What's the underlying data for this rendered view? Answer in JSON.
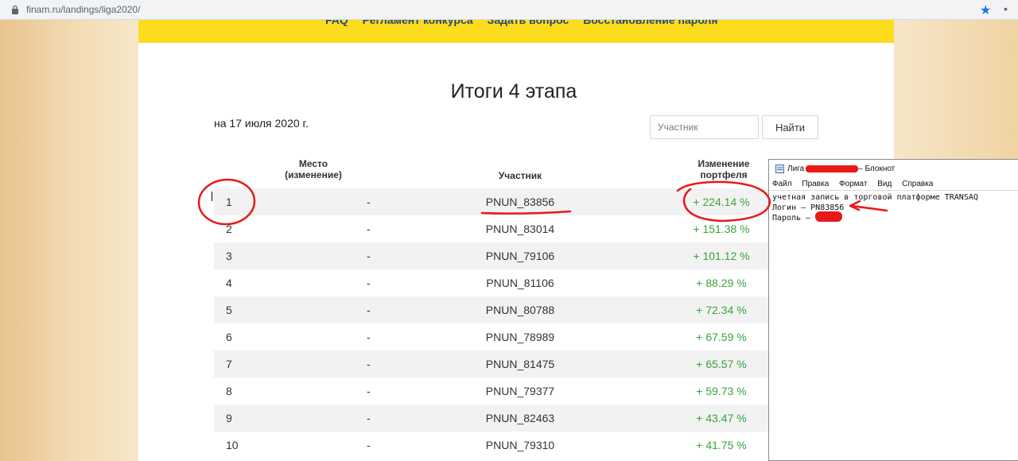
{
  "browser": {
    "url": "finam.ru/landings/liga2020/"
  },
  "nav": {
    "links": [
      "FAQ",
      "Регламент конкурса",
      "Задать вопрос",
      "Восстановление пароля"
    ]
  },
  "page": {
    "title": "Итоги 4 этапа",
    "date": "на 17 июля 2020 г."
  },
  "search": {
    "placeholder": "Участник",
    "button_label": "Найти"
  },
  "table": {
    "headers": {
      "place": [
        "Место",
        "(изменение)"
      ],
      "participant": "Участник",
      "change": [
        "Изменение",
        "портфеля"
      ]
    },
    "rows": [
      {
        "place": "1",
        "move": "-",
        "name": "PNUN_83856",
        "change": "+ 224.14 %"
      },
      {
        "place": "2",
        "move": "-",
        "name": "PNUN_83014",
        "change": "+ 151.38 %"
      },
      {
        "place": "3",
        "move": "-",
        "name": "PNUN_79106",
        "change": "+ 101.12 %"
      },
      {
        "place": "4",
        "move": "-",
        "name": "PNUN_81106",
        "change": "+ 88.29 %"
      },
      {
        "place": "5",
        "move": "-",
        "name": "PNUN_80788",
        "change": "+ 72.34 %"
      },
      {
        "place": "6",
        "move": "-",
        "name": "PNUN_78989",
        "change": "+ 67.59 %"
      },
      {
        "place": "7",
        "move": "-",
        "name": "PNUN_81475",
        "change": "+ 65.57 %"
      },
      {
        "place": "8",
        "move": "-",
        "name": "PNUN_79377",
        "change": "+ 59.73 %"
      },
      {
        "place": "9",
        "move": "-",
        "name": "PNUN_82463",
        "change": "+ 43.47 %"
      },
      {
        "place": "10",
        "move": "-",
        "name": "PNUN_79310",
        "change": "+ 41.75 %"
      }
    ]
  },
  "notepad": {
    "title_prefix": "Лига",
    "title_suffix": "– Блокнот",
    "menu": [
      "Файл",
      "Правка",
      "Формат",
      "Вид",
      "Справка"
    ],
    "lines": [
      "учетная запись в торговой платформе TRANSAQ",
      "Логин – PN83856",
      "Пароль –"
    ]
  },
  "colors": {
    "nav_bg": "#fcdc1c",
    "nav_link": "#25477c",
    "positive": "#3aa33a",
    "annotation": "#e81818",
    "star": "#1a73e8"
  }
}
